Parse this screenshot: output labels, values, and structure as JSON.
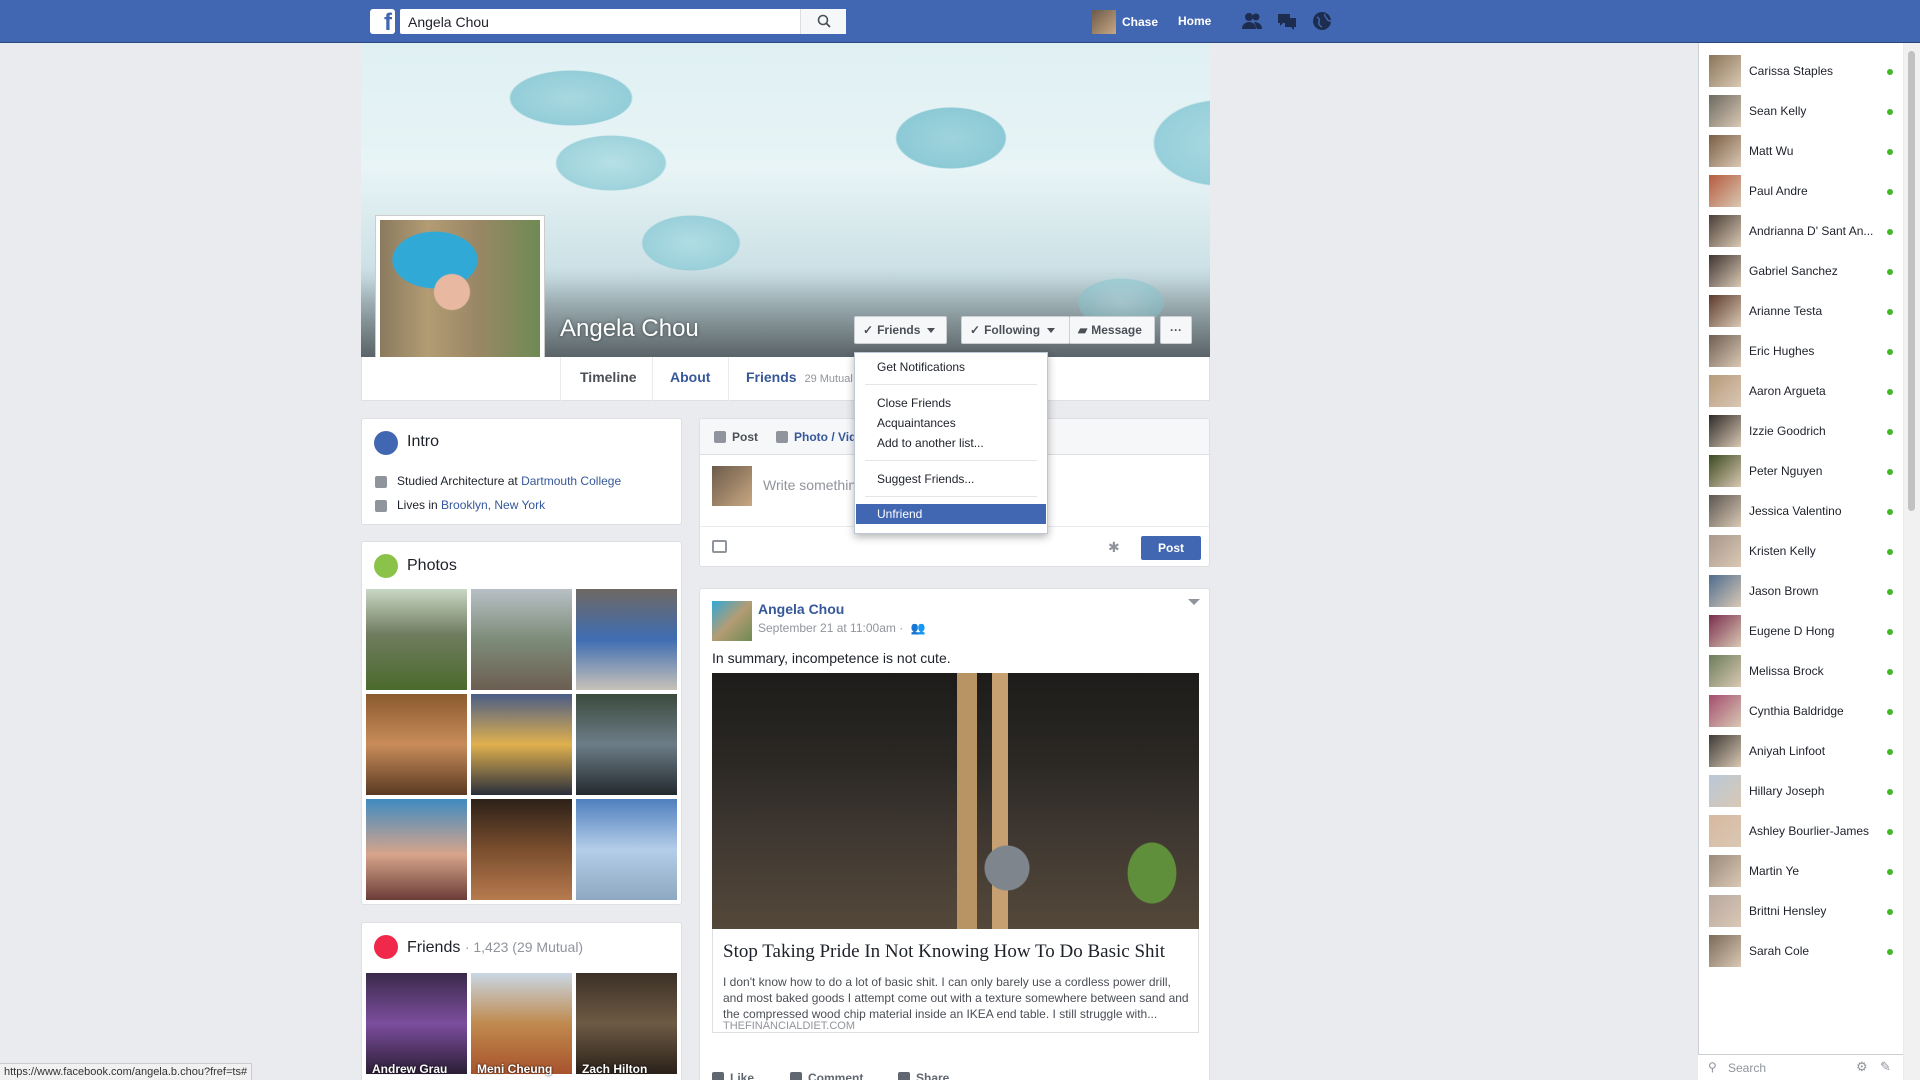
{
  "search": {
    "value": "Angela Chou"
  },
  "nav": {
    "user": "Chase",
    "home": "Home"
  },
  "profile": {
    "name": "Angela Chou",
    "buttons": {
      "friends": "Friends",
      "following": "Following",
      "message": "Message",
      "more": "···"
    },
    "tabs": {
      "timeline": "Timeline",
      "about": "About",
      "friends": "Friends",
      "mutual": "29 Mutual"
    }
  },
  "friends_menu": {
    "items": [
      "Get Notifications",
      "Close Friends",
      "Acquaintances",
      "Add to another list...",
      "Suggest Friends...",
      "Unfriend"
    ],
    "selected": "Unfriend"
  },
  "intro": {
    "title": "Intro",
    "studied_prefix": "Studied Architecture at ",
    "studied_link": "Dartmouth College",
    "lives_prefix": "Lives in ",
    "lives_link": "Brooklyn, New York"
  },
  "photos": {
    "title": "Photos"
  },
  "friends_card": {
    "title": "Friends",
    "count": "· 1,423 (29 Mutual)",
    "people": [
      "Andrew Grau",
      "Meni Cheung",
      "Zach Hilton"
    ]
  },
  "composer": {
    "tab_post": "Post",
    "tab_photo": "Photo / Vid",
    "placeholder": "Write something",
    "post_button": "Post"
  },
  "post": {
    "author": "Angela Chou",
    "date": "September 21 at 11:00am ·",
    "text": "In summary, incompetence is not cute.",
    "link_title": "Stop Taking Pride In Not Knowing How To Do Basic Shit",
    "link_desc": "I don't know how to do a lot of basic shit. I can only barely use a cordless power drill, and most baked goods I attempt come out with a texture somewhere between sand and the compressed wood chip material inside an IKEA end table. I still struggle with...",
    "link_source": "THEFINANCIALDIET.COM",
    "actions": {
      "like": "Like",
      "comment": "Comment",
      "share": "Share"
    }
  },
  "chat": {
    "contacts": [
      "Carissa Staples",
      "Sean Kelly",
      "Matt Wu",
      "Paul Andre",
      "Andrianna D' Sant An...",
      "Gabriel Sanchez",
      "Arianne Testa",
      "Eric Hughes",
      "Aaron Argueta",
      "Izzie Goodrich",
      "Peter Nguyen",
      "Jessica Valentino",
      "Kristen Kelly",
      "Jason Brown",
      "Eugene D Hong",
      "Melissa Brock",
      "Cynthia Baldridge",
      "Aniyah Linfoot",
      "Hillary Joseph",
      "Ashley Bourlier-James",
      "Martin Ye",
      "Brittni Hensley",
      "Sarah Cole"
    ],
    "search_placeholder": "Search"
  },
  "status_bar": {
    "url": "https://www.facebook.com/angela.b.chou?fref=ts#"
  },
  "colors": {
    "brand": "#4267b2",
    "link": "#365899",
    "online": "#42b72a"
  }
}
